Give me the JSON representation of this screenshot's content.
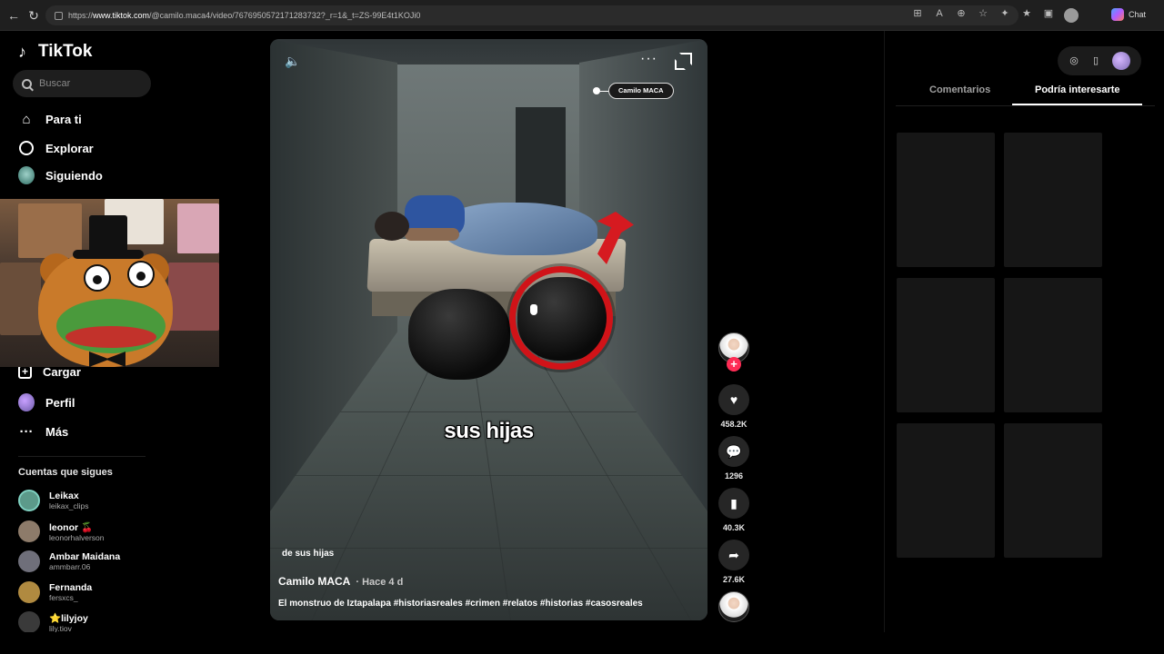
{
  "browser": {
    "url_prefix": "https://",
    "url_host": "www.tiktok.com",
    "url_path": "/@camilo.maca4/video/7676950572171283732?_r=1&_t=ZS-99E4t1KOJi0",
    "chat_label": "Chat"
  },
  "sidebar": {
    "logo_text": "TikTok",
    "search_placeholder": "Buscar",
    "nav": [
      {
        "label": "Para ti",
        "icon": "home-icon"
      },
      {
        "label": "Explorar",
        "icon": "compass-icon"
      },
      {
        "label": "Siguiendo",
        "icon": "following-icon"
      },
      {
        "label": "Cargar",
        "icon": "upload-icon"
      },
      {
        "label": "Perfil",
        "icon": "profile-icon"
      },
      {
        "label": "Más",
        "icon": "more-icon"
      }
    ],
    "following_title": "Cuentas que sigues",
    "accounts": [
      {
        "name": "Leikax",
        "handle": "leikax_clips",
        "color": "#5c9a8a"
      },
      {
        "name": "leonor 🍒",
        "handle": "leonorhalverson",
        "color": "#8d7b6a"
      },
      {
        "name": "Ambar Maidana",
        "handle": "ammbarr.06",
        "color": "#6f6f7a"
      },
      {
        "name": "Fernanda",
        "handle": "fersxcs_",
        "color": "#b08a40"
      },
      {
        "name": "⭐lilyjoy",
        "handle": "lily.tiov",
        "color": "#3a3a3a"
      }
    ]
  },
  "video": {
    "creator_tag": "Camilo MACA",
    "subtitle": "sus hijas",
    "sticker_text": "de sus hijas",
    "author": "Camilo MACA",
    "time_ago": "· Hace 4 d",
    "caption": "El monstruo de Iztapalapa  #historiasreales #crimen #relatos #historias #casosreales"
  },
  "actions": {
    "likes": "458.2K",
    "comments": "1296",
    "saves": "40.3K",
    "shares": "27.6K"
  },
  "right_panel": {
    "tabs": [
      "Comentarios",
      "Podría interesarte"
    ],
    "active_tab": "Podría interesarte"
  },
  "colors": {
    "accent": "#fe2c55",
    "highlight_red": "#d01318",
    "background": "#000000"
  }
}
